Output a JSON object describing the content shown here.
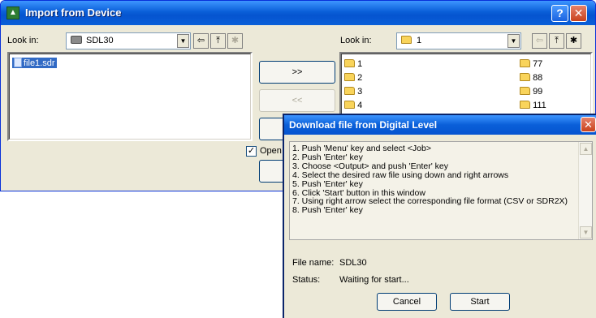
{
  "main_window": {
    "title": "Import from Device",
    "help_glyph": "?",
    "close_glyph": "✕",
    "left": {
      "look_in_label": "Look in:",
      "look_in_value": "SDL30",
      "files": [
        "file1.sdr"
      ]
    },
    "right": {
      "look_in_label": "Look in:",
      "look_in_value": "1",
      "folders_col1": [
        "1",
        "2",
        "3",
        "4"
      ],
      "folders_col2": [
        "77",
        "88",
        "99",
        "111"
      ]
    },
    "move_right_label": ">>",
    "move_left_label": "<<",
    "open_checkbox_label": "Open",
    "open_checked": true,
    "icons": {
      "back": "⇦",
      "up_folder": "⤒",
      "new_folder": "✱"
    }
  },
  "dialog": {
    "title": "Download file from Digital Level",
    "close_glyph": "✕",
    "instructions": [
      "1. Push 'Menu' key and select <Job>",
      "2. Push 'Enter' key",
      "3. Choose <Output> and push 'Enter' key",
      "4. Select the desired raw file using down and right arrows",
      "5. Push 'Enter' key",
      "6. Click 'Start' button in this window",
      "7. Using right arrow select the corresponding file format (CSV or SDR2X)",
      "8. Push 'Enter' key"
    ],
    "file_name_label": "File name:",
    "file_name_value": "SDL30",
    "status_label": "Status:",
    "status_value": "Waiting for start...",
    "cancel_label": "Cancel",
    "start_label": "Start"
  },
  "colors": {
    "title_blue": "#0a5fd8",
    "selection_blue": "#316ac5",
    "window_face": "#ece9d8",
    "close_red": "#c9421d"
  }
}
